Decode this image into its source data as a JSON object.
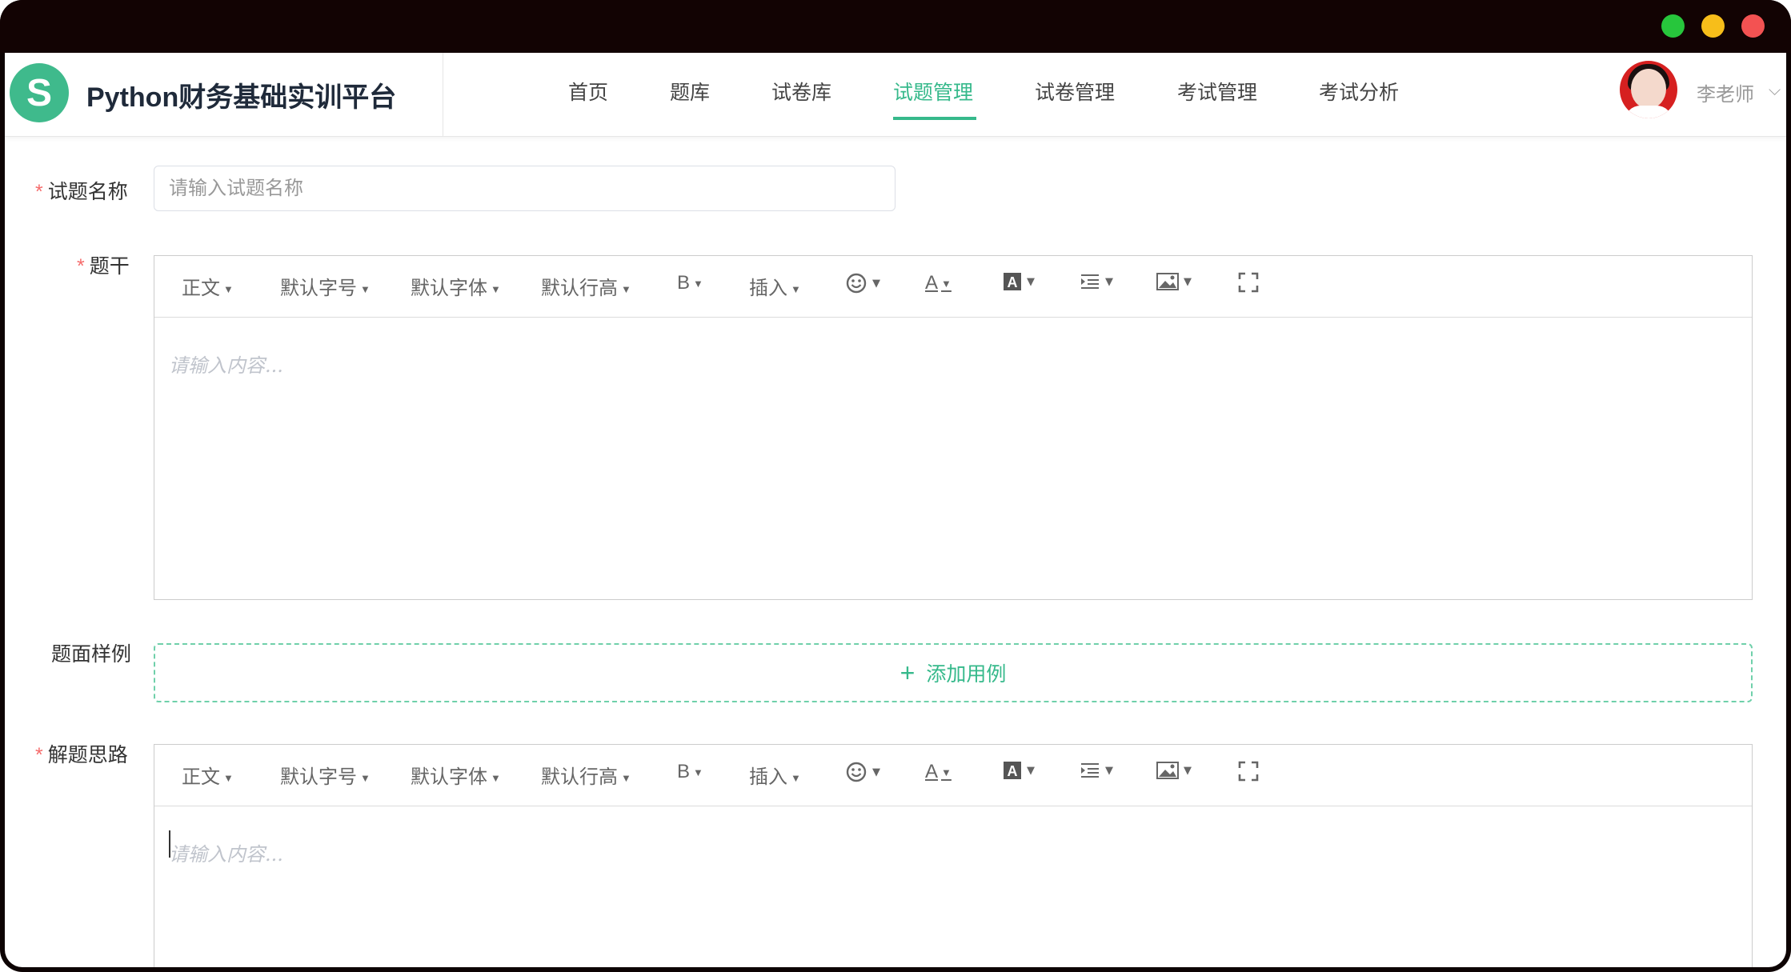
{
  "header": {
    "logo_letter": "S",
    "brand": "Python财务基础实训平台",
    "nav": [
      {
        "label": "首页"
      },
      {
        "label": "题库"
      },
      {
        "label": "试卷库"
      },
      {
        "label": "试题管理"
      },
      {
        "label": "试卷管理"
      },
      {
        "label": "考试管理"
      },
      {
        "label": "考试分析"
      }
    ],
    "active_nav": "试题管理",
    "user": "李老师",
    "user_chevron": "⌵"
  },
  "form": {
    "name": {
      "label": "试题名称",
      "placeholder": "请输入试题名称"
    },
    "stem": {
      "label": "题干",
      "placeholder": "请输入内容..."
    },
    "sample": {
      "label": "题面样例",
      "add_button": "添加用例"
    },
    "solution": {
      "label": "解题思路",
      "placeholder": "请输入内容..."
    }
  },
  "toolbar": {
    "paragraph": "正文",
    "font_size": "默认字号",
    "font_family": "默认字体",
    "line_height": "默认行高",
    "bold": "B",
    "insert": "插入",
    "emoji_icon": "emoji-icon",
    "font_color": "A",
    "bg_color": "A",
    "indent_icon": "indent-icon",
    "image_icon": "image-icon",
    "fullscreen_icon": "fullscreen-icon"
  },
  "colors": {
    "accent": "#36b98b",
    "required": "#f56c6c",
    "logo": "#3fba8c"
  }
}
